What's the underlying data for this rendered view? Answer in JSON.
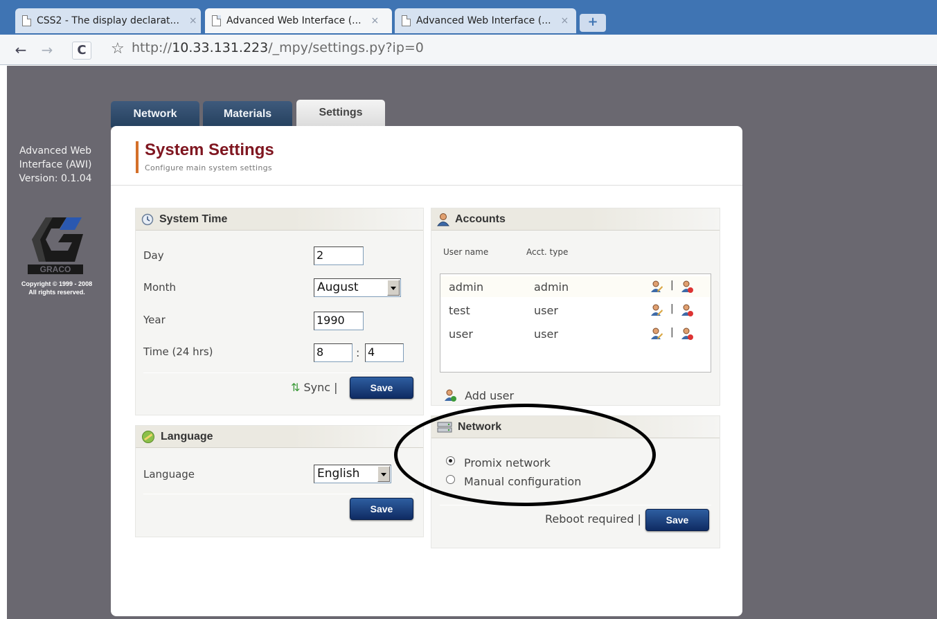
{
  "browser": {
    "tabs": [
      {
        "label": "CSS2 - The display declarat...",
        "active": false
      },
      {
        "label": "Advanced Web Interface (...",
        "active": true
      },
      {
        "label": "Advanced Web Interface (...",
        "active": false
      }
    ],
    "tab_close_glyph": "×",
    "new_tab_glyph": "+",
    "url_prefix": "http://",
    "url_host": "10.33.131.223",
    "url_path": "/_mpy/settings.py?ip=0"
  },
  "sidebar": {
    "app_name_line1": "Advanced Web",
    "app_name_line2": "Interface (AWI)",
    "version": "Version: 0.1.04",
    "logo_text": "GRACO",
    "copyright_line1": "Copyright © 1999 - 2008",
    "copyright_line2": "All rights reserved."
  },
  "main_tabs": [
    {
      "label": "Network",
      "active": false
    },
    {
      "label": "Materials",
      "active": false
    },
    {
      "label": "Settings",
      "active": true
    }
  ],
  "page": {
    "title": "System Settings",
    "subtitle": "Configure main system settings"
  },
  "system_time": {
    "header": "System Time",
    "day_label": "Day",
    "day_value": "2",
    "month_label": "Month",
    "month_value": "August",
    "year_label": "Year",
    "year_value": "1990",
    "time_label": "Time (24 hrs)",
    "hour_value": "8",
    "time_separator": ":",
    "minute_value": "4",
    "sync_label": "Sync |",
    "save_label": "Save"
  },
  "language": {
    "header": "Language",
    "label": "Language",
    "value": "English",
    "save_label": "Save"
  },
  "accounts": {
    "header": "Accounts",
    "col_username": "User name",
    "col_type": "Acct. type",
    "separator": "|",
    "rows": [
      {
        "name": "admin",
        "type": "admin"
      },
      {
        "name": "test",
        "type": "user"
      },
      {
        "name": "user",
        "type": "user"
      }
    ],
    "add_user_label": "Add user"
  },
  "network": {
    "header": "Network",
    "options": [
      {
        "label": "Promix network",
        "selected": true
      },
      {
        "label": "Manual configuration",
        "selected": false
      }
    ],
    "reboot_label": "Reboot required |",
    "save_label": "Save"
  },
  "colors": {
    "tab_bar": "#3f74b3",
    "page_background": "#6a6870",
    "title": "#7f1620",
    "title_accent": "#d4702a",
    "save_button": "#1b3f7e",
    "main_tab_dark": "#2f4a6b"
  }
}
